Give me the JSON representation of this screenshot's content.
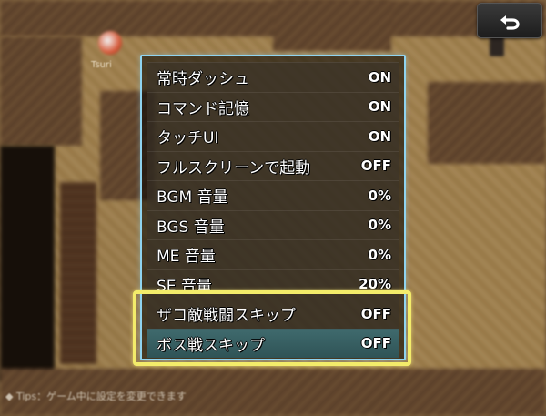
{
  "back_button": {
    "icon": "return-arrow-icon"
  },
  "npc": {
    "label": "Tsuri"
  },
  "hint": {
    "text": "◆ Tips：ゲーム中に設定を変更できます"
  },
  "options": {
    "items": [
      {
        "label": "常時ダッシュ",
        "value": "ON"
      },
      {
        "label": "コマンド記憶",
        "value": "ON"
      },
      {
        "label": "タッチUI",
        "value": "ON"
      },
      {
        "label": "フルスクリーンで起動",
        "value": "OFF"
      },
      {
        "label": "BGM 音量",
        "value": "0%"
      },
      {
        "label": "BGS 音量",
        "value": "0%"
      },
      {
        "label": "ME 音量",
        "value": "0%"
      },
      {
        "label": "SE 音量",
        "value": "20%"
      },
      {
        "label": "ザコ敵戦闘スキップ",
        "value": "OFF"
      },
      {
        "label": "ボス戦スキップ",
        "value": "OFF"
      }
    ],
    "selected_index": 9
  },
  "colors": {
    "window_border": "#8fd3ef",
    "highlight": "#f3ec6a",
    "selected_row": "#3f6a6d"
  }
}
